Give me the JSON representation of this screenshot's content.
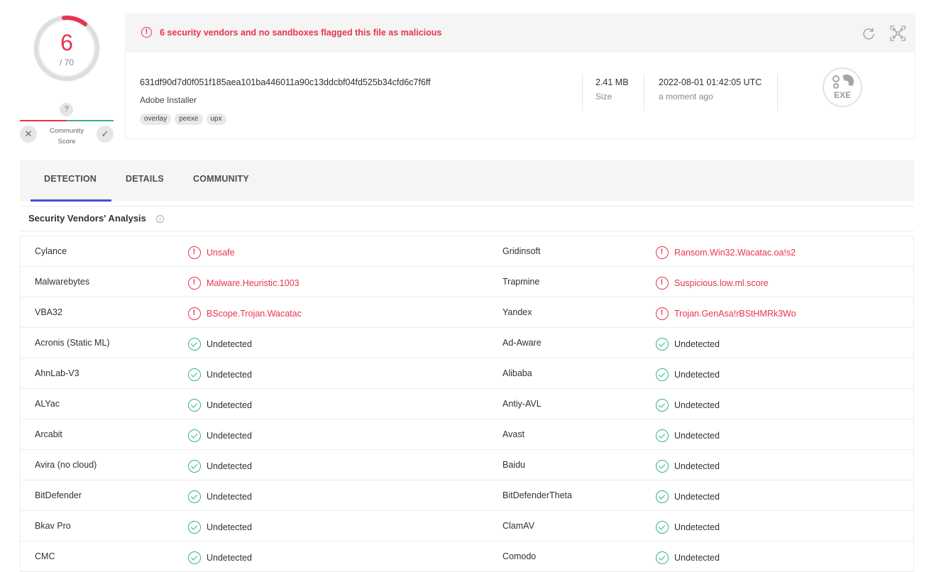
{
  "score": {
    "detections": "6",
    "total": "/ 70",
    "community_question": "?",
    "community_label_line1": "Community",
    "community_label_line2": "Score"
  },
  "alert": {
    "icon": "alert-circle-icon",
    "text": "6 security vendors and no sandboxes flagged this file as malicious"
  },
  "file": {
    "hash": "631df90d7d0f051f185aea101ba446011a90c13ddcbf04fd525b34cfd6c7f6ff",
    "name": "Adobe Installer",
    "tags": [
      "overlay",
      "peexe",
      "upx"
    ],
    "size_value": "2.41 MB",
    "size_label": "Size",
    "date_value": "2022-08-01 01:42:05 UTC",
    "date_label": "a moment ago",
    "type_label": "EXE"
  },
  "tabs": [
    {
      "label": "DETECTION",
      "active": true
    },
    {
      "label": "DETAILS",
      "active": false
    },
    {
      "label": "COMMUNITY",
      "active": false
    }
  ],
  "section": {
    "title": "Security Vendors' Analysis",
    "info_icon": "info-icon"
  },
  "colors": {
    "malicious": "#e8344e",
    "undetected": "#36b37e",
    "tab_accent": "#3f51d4"
  },
  "vendors": [
    [
      {
        "name": "Cylance",
        "result": "Unsafe",
        "status": "malicious"
      },
      {
        "name": "Gridinsoft",
        "result": "Ransom.Win32.Wacatac.oa!s2",
        "status": "malicious"
      }
    ],
    [
      {
        "name": "Malwarebytes",
        "result": "Malware.Heuristic.1003",
        "status": "malicious"
      },
      {
        "name": "Trapmine",
        "result": "Suspicious.low.ml.score",
        "status": "malicious"
      }
    ],
    [
      {
        "name": "VBA32",
        "result": "BScope.Trojan.Wacatac",
        "status": "malicious"
      },
      {
        "name": "Yandex",
        "result": "Trojan.GenAsa!rBStHMRk3Wo",
        "status": "malicious"
      }
    ],
    [
      {
        "name": "Acronis (Static ML)",
        "result": "Undetected",
        "status": "undetected"
      },
      {
        "name": "Ad-Aware",
        "result": "Undetected",
        "status": "undetected"
      }
    ],
    [
      {
        "name": "AhnLab-V3",
        "result": "Undetected",
        "status": "undetected"
      },
      {
        "name": "Alibaba",
        "result": "Undetected",
        "status": "undetected"
      }
    ],
    [
      {
        "name": "ALYac",
        "result": "Undetected",
        "status": "undetected"
      },
      {
        "name": "Antiy-AVL",
        "result": "Undetected",
        "status": "undetected"
      }
    ],
    [
      {
        "name": "Arcabit",
        "result": "Undetected",
        "status": "undetected"
      },
      {
        "name": "Avast",
        "result": "Undetected",
        "status": "undetected"
      }
    ],
    [
      {
        "name": "Avira (no cloud)",
        "result": "Undetected",
        "status": "undetected"
      },
      {
        "name": "Baidu",
        "result": "Undetected",
        "status": "undetected"
      }
    ],
    [
      {
        "name": "BitDefender",
        "result": "Undetected",
        "status": "undetected"
      },
      {
        "name": "BitDefenderTheta",
        "result": "Undetected",
        "status": "undetected"
      }
    ],
    [
      {
        "name": "Bkav Pro",
        "result": "Undetected",
        "status": "undetected"
      },
      {
        "name": "ClamAV",
        "result": "Undetected",
        "status": "undetected"
      }
    ],
    [
      {
        "name": "CMC",
        "result": "Undetected",
        "status": "undetected"
      },
      {
        "name": "Comodo",
        "result": "Undetected",
        "status": "undetected"
      }
    ]
  ]
}
